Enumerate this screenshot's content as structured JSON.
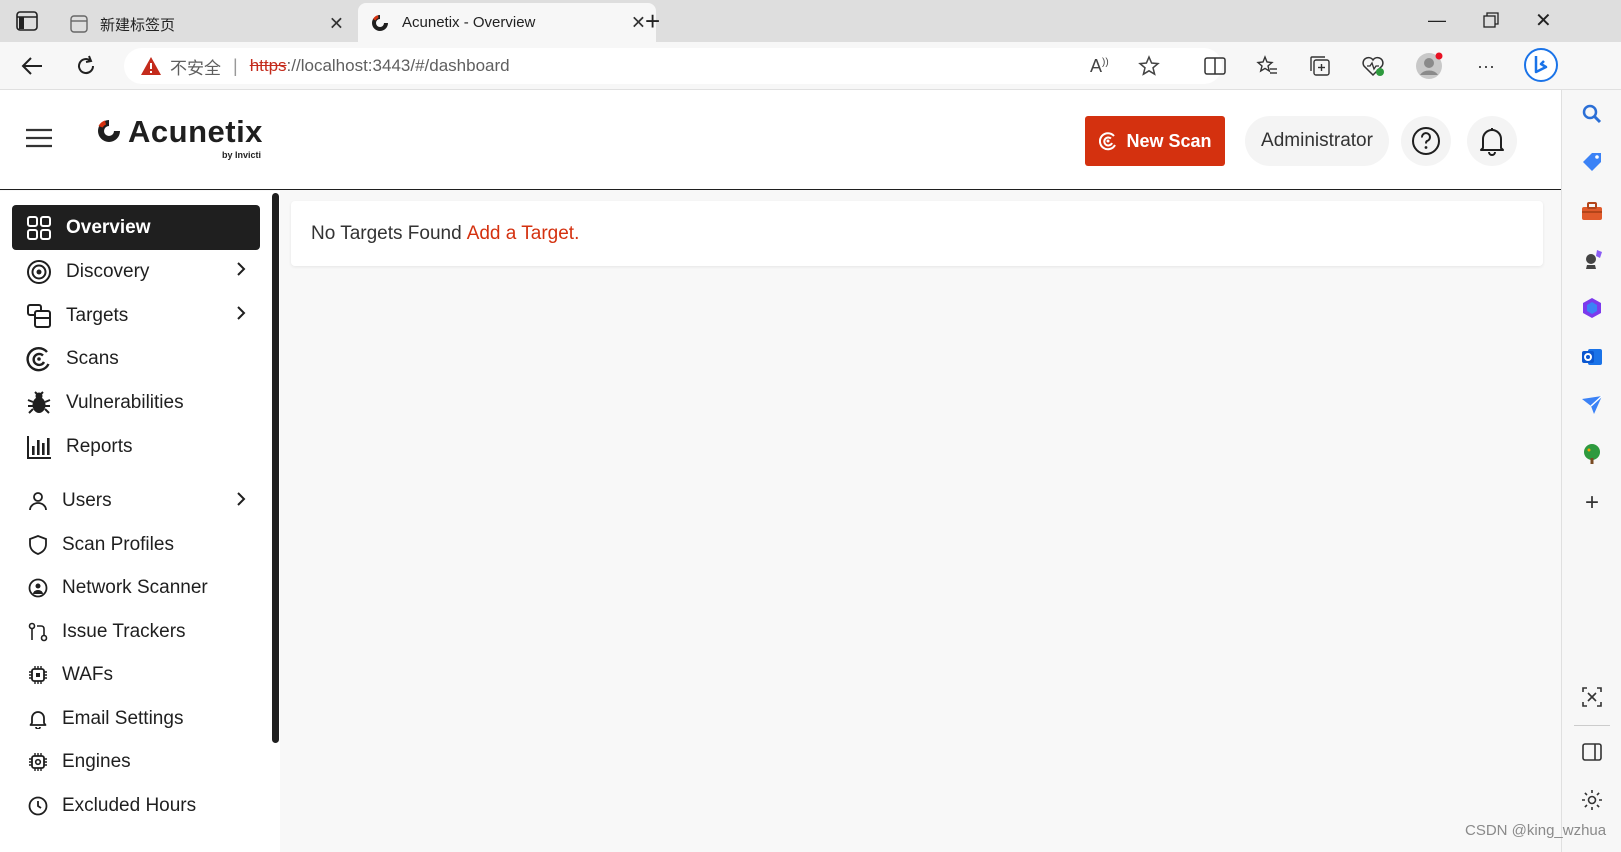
{
  "browser": {
    "tabs": [
      {
        "title": "新建标签页",
        "active": false
      },
      {
        "title": "Acunetix - Overview",
        "active": true
      }
    ],
    "address": {
      "security_label": "不安全",
      "url_scheme": "https",
      "url_rest": "://localhost:3443/#/dashboard"
    }
  },
  "header": {
    "logo": "Acunetix",
    "logo_sub": "by Invicti",
    "new_scan_label": "New Scan",
    "user_label": "Administrator"
  },
  "sidebar": {
    "primary": [
      {
        "label": "Overview",
        "icon": "grid-icon",
        "active": true,
        "chevron": false
      },
      {
        "label": "Discovery",
        "icon": "target-icon",
        "active": false,
        "chevron": true
      },
      {
        "label": "Targets",
        "icon": "targets-icon",
        "active": false,
        "chevron": true
      },
      {
        "label": "Scans",
        "icon": "scans-icon",
        "active": false,
        "chevron": false
      },
      {
        "label": "Vulnerabilities",
        "icon": "bug-icon",
        "active": false,
        "chevron": false
      },
      {
        "label": "Reports",
        "icon": "chart-icon",
        "active": false,
        "chevron": false
      }
    ],
    "settings": [
      {
        "label": "Users",
        "icon": "user-icon",
        "chevron": true
      },
      {
        "label": "Scan Profiles",
        "icon": "shield-icon",
        "chevron": false
      },
      {
        "label": "Network Scanner",
        "icon": "network-icon",
        "chevron": false
      },
      {
        "label": "Issue Trackers",
        "icon": "tracker-icon",
        "chevron": false
      },
      {
        "label": "WAFs",
        "icon": "chip-icon",
        "chevron": false
      },
      {
        "label": "Email Settings",
        "icon": "bell-icon",
        "chevron": false
      },
      {
        "label": "Engines",
        "icon": "engine-icon",
        "chevron": false
      },
      {
        "label": "Excluded Hours",
        "icon": "clock-icon",
        "chevron": false
      }
    ]
  },
  "content": {
    "empty_text": "No Targets Found",
    "add_link": "Add a Target."
  },
  "watermark": "CSDN @king_wzhua",
  "colors": {
    "accent": "#d4310f",
    "dark": "#1f1f1f"
  }
}
